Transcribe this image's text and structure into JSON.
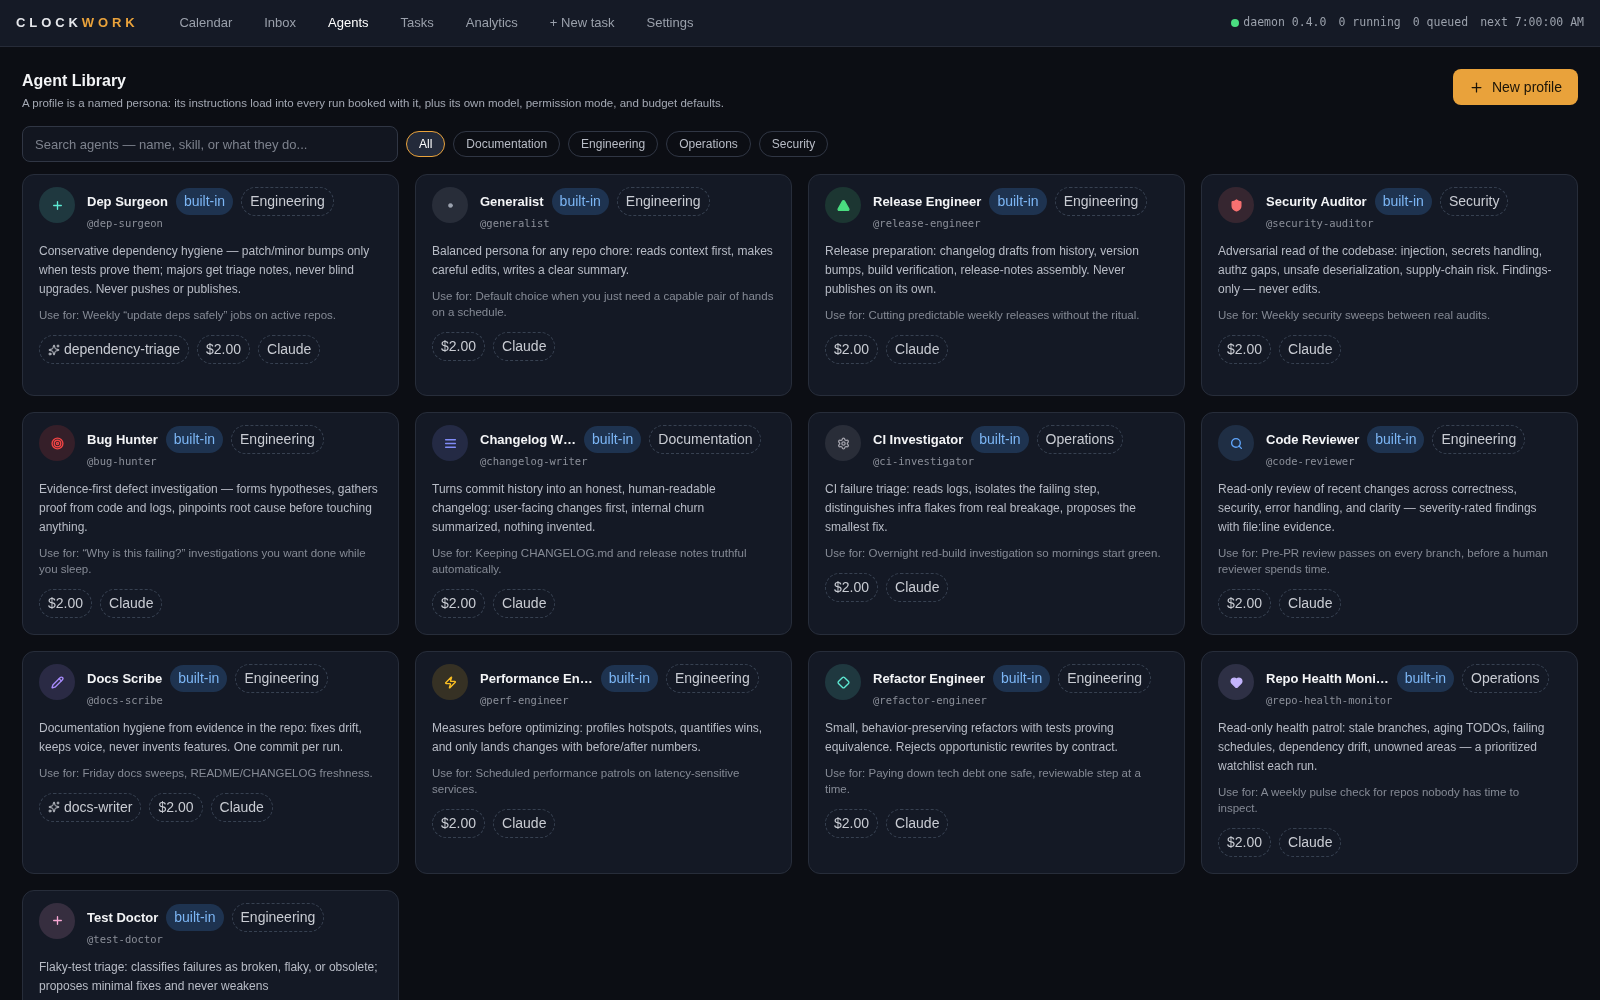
{
  "brand": {
    "first": "CLOCK",
    "second": "WORK"
  },
  "nav": [
    {
      "label": "Calendar",
      "selected": false
    },
    {
      "label": "Inbox",
      "selected": false
    },
    {
      "label": "Agents",
      "selected": true
    },
    {
      "label": "Tasks",
      "selected": false
    },
    {
      "label": "Analytics",
      "selected": false
    },
    {
      "label": "+ New task",
      "selected": false
    },
    {
      "label": "Settings",
      "selected": false
    }
  ],
  "status": {
    "daemon": "daemon 0.4.0",
    "online": true,
    "running": "0 running",
    "queued": "0 queued",
    "next": "next 7:00:00 AM"
  },
  "header": {
    "title": "Agent Library",
    "subtitle": "A profile is a named persona: its instructions load into every run booked with it, plus its own model, permission mode, and budget defaults.",
    "button": "New profile"
  },
  "search": {
    "placeholder": "Search agents — name, skill, or what they do..."
  },
  "filters": [
    {
      "label": "All",
      "selected": true
    },
    {
      "label": "Documentation",
      "selected": false
    },
    {
      "label": "Engineering",
      "selected": false
    },
    {
      "label": "Operations",
      "selected": false
    },
    {
      "label": "Security",
      "selected": false
    }
  ],
  "agents": [
    {
      "name": "Dep Surgeon",
      "badge": "built-in",
      "category": "Engineering",
      "handle": "@dep-surgeon",
      "color": "#5eead4",
      "description": "Conservative dependency hygiene — patch/minor bumps only when tests prove them; majors get triage notes, never blind upgrades. Never pushes or publishes.",
      "use_for": "Use for: Weekly “update deps safely” jobs on active repos.",
      "skill": "dependency-triage",
      "budget": "$2.00",
      "model": "Claude"
    },
    {
      "name": "Generalist",
      "badge": "built-in",
      "category": "Engineering",
      "handle": "@generalist",
      "color": "#9ca3af",
      "description": "Balanced persona for any repo chore: reads context first, makes careful edits, writes a clear summary.",
      "use_for": "Use for: Default choice when you just need a capable pair of hands on a schedule.",
      "budget": "$2.00",
      "model": "Claude"
    },
    {
      "name": "Release Engineer",
      "badge": "built-in",
      "category": "Engineering",
      "handle": "@release-engineer",
      "color": "#4ade80",
      "description": "Release preparation: changelog drafts from history, version bumps, build verification, release-notes assembly. Never publishes on its own.",
      "use_for": "Use for: Cutting predictable weekly releases without the ritual.",
      "budget": "$2.00",
      "model": "Claude"
    },
    {
      "name": "Security Auditor",
      "badge": "built-in",
      "category": "Security",
      "handle": "@security-auditor",
      "color": "#f87171",
      "description": "Adversarial read of the codebase: injection, secrets handling, authz gaps, unsafe deserialization, supply-chain risk. Findings-only — never edits.",
      "use_for": "Use for: Weekly security sweeps between real audits.",
      "budget": "$2.00",
      "model": "Claude"
    },
    {
      "name": "Bug Hunter",
      "badge": "built-in",
      "category": "Engineering",
      "handle": "@bug-hunter",
      "color": "#ef4444",
      "description": "Evidence-first defect investigation — forms hypotheses, gathers proof from code and logs, pinpoints root cause before touching anything.",
      "use_for": "Use for: “Why is this failing?” investigations you want done while you sleep.",
      "budget": "$2.00",
      "model": "Claude"
    },
    {
      "name": "Changelog W…",
      "badge": "built-in",
      "category": "Documentation",
      "handle": "@changelog-writer",
      "color": "#818cf8",
      "description": "Turns commit history into an honest, human-readable changelog: user-facing changes first, internal churn summarized, nothing invented.",
      "use_for": "Use for: Keeping CHANGELOG.md and release notes truthful automatically.",
      "budget": "$2.00",
      "model": "Claude"
    },
    {
      "name": "CI Investigator",
      "badge": "built-in",
      "category": "Operations",
      "handle": "@ci-investigator",
      "color": "#a1a1aa",
      "description": "CI failure triage: reads logs, isolates the failing step, distinguishes infra flakes from real breakage, proposes the smallest fix.",
      "use_for": "Use for: Overnight red-build investigation so mornings start green.",
      "budget": "$2.00",
      "model": "Claude"
    },
    {
      "name": "Code Reviewer",
      "badge": "built-in",
      "category": "Engineering",
      "handle": "@code-reviewer",
      "color": "#60a5fa",
      "description": "Read-only review of recent changes across correctness, security, error handling, and clarity — severity-rated findings with file:line evidence.",
      "use_for": "Use for: Pre-PR review passes on every branch, before a human reviewer spends time.",
      "budget": "$2.00",
      "model": "Claude"
    },
    {
      "name": "Docs Scribe",
      "badge": "built-in",
      "category": "Engineering",
      "handle": "@docs-scribe",
      "color": "#a78bfa",
      "description": "Documentation hygiene from evidence in the repo: fixes drift, keeps voice, never invents features. One commit per run.",
      "use_for": "Use for: Friday docs sweeps, README/CHANGELOG freshness.",
      "skill": "docs-writer",
      "budget": "$2.00",
      "model": "Claude"
    },
    {
      "name": "Performance En…",
      "badge": "built-in",
      "category": "Engineering",
      "handle": "@perf-engineer",
      "color": "#fbbf24",
      "description": "Measures before optimizing: profiles hotspots, quantifies wins, and only lands changes with before/after numbers.",
      "use_for": "Use for: Scheduled performance patrols on latency-sensitive services.",
      "budget": "$2.00",
      "model": "Claude"
    },
    {
      "name": "Refactor Engineer",
      "badge": "built-in",
      "category": "Engineering",
      "handle": "@refactor-engineer",
      "color": "#5eead4",
      "description": "Small, behavior-preserving refactors with tests proving equivalence. Rejects opportunistic rewrites by contract.",
      "use_for": "Use for: Paying down tech debt one safe, reviewable step at a time.",
      "budget": "$2.00",
      "model": "Claude"
    },
    {
      "name": "Repo Health Moni…",
      "badge": "built-in",
      "category": "Operations",
      "handle": "@repo-health-monitor",
      "color": "#c4b5fd",
      "description": "Read-only health patrol: stale branches, aging TODOs, failing schedules, dependency drift, unowned areas — a prioritized watchlist each run.",
      "use_for": "Use for: A weekly pulse check for repos nobody has time to inspect.",
      "budget": "$2.00",
      "model": "Claude"
    },
    {
      "name": "Test Doctor",
      "badge": "built-in",
      "category": "Engineering",
      "handle": "@test-doctor",
      "color": "#f9a8d4",
      "description": "Flaky-test triage: classifies failures as broken, flaky, or obsolete; proposes minimal fixes and never weakens"
    }
  ]
}
